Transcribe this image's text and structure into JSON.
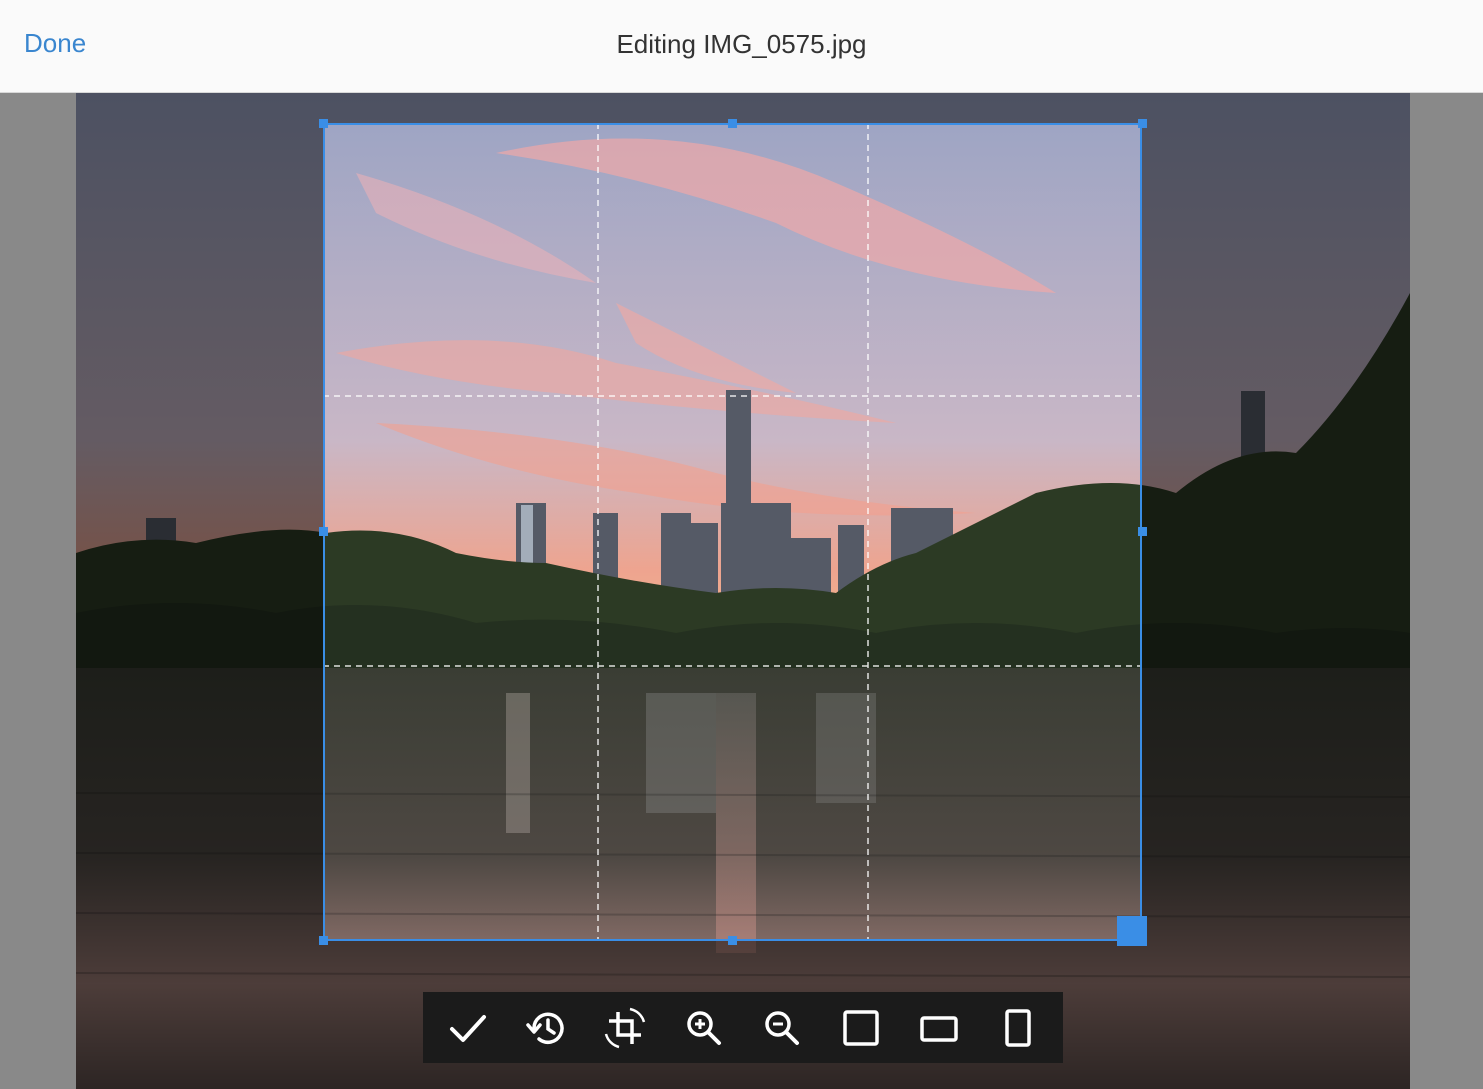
{
  "header": {
    "done_label": "Done",
    "title": "Editing IMG_0575.jpg"
  },
  "photo": {
    "subject": "city-skyline-sunset-lake"
  },
  "crop": {
    "aspect": "square",
    "grid": "thirds"
  },
  "toolbar": {
    "tools": [
      {
        "name": "confirm",
        "icon": "check-icon"
      },
      {
        "name": "reset",
        "icon": "history-icon"
      },
      {
        "name": "rotate",
        "icon": "crop-rotate-icon"
      },
      {
        "name": "zoom-in",
        "icon": "zoom-in-icon"
      },
      {
        "name": "zoom-out",
        "icon": "zoom-out-icon"
      },
      {
        "name": "aspect-square",
        "icon": "square-icon"
      },
      {
        "name": "aspect-landscape",
        "icon": "landscape-icon"
      },
      {
        "name": "aspect-portrait",
        "icon": "portrait-icon"
      }
    ]
  },
  "colors": {
    "accent": "#3a8ee6",
    "link": "#3a86cf",
    "toolbar_bg": "#1b1b1b"
  }
}
